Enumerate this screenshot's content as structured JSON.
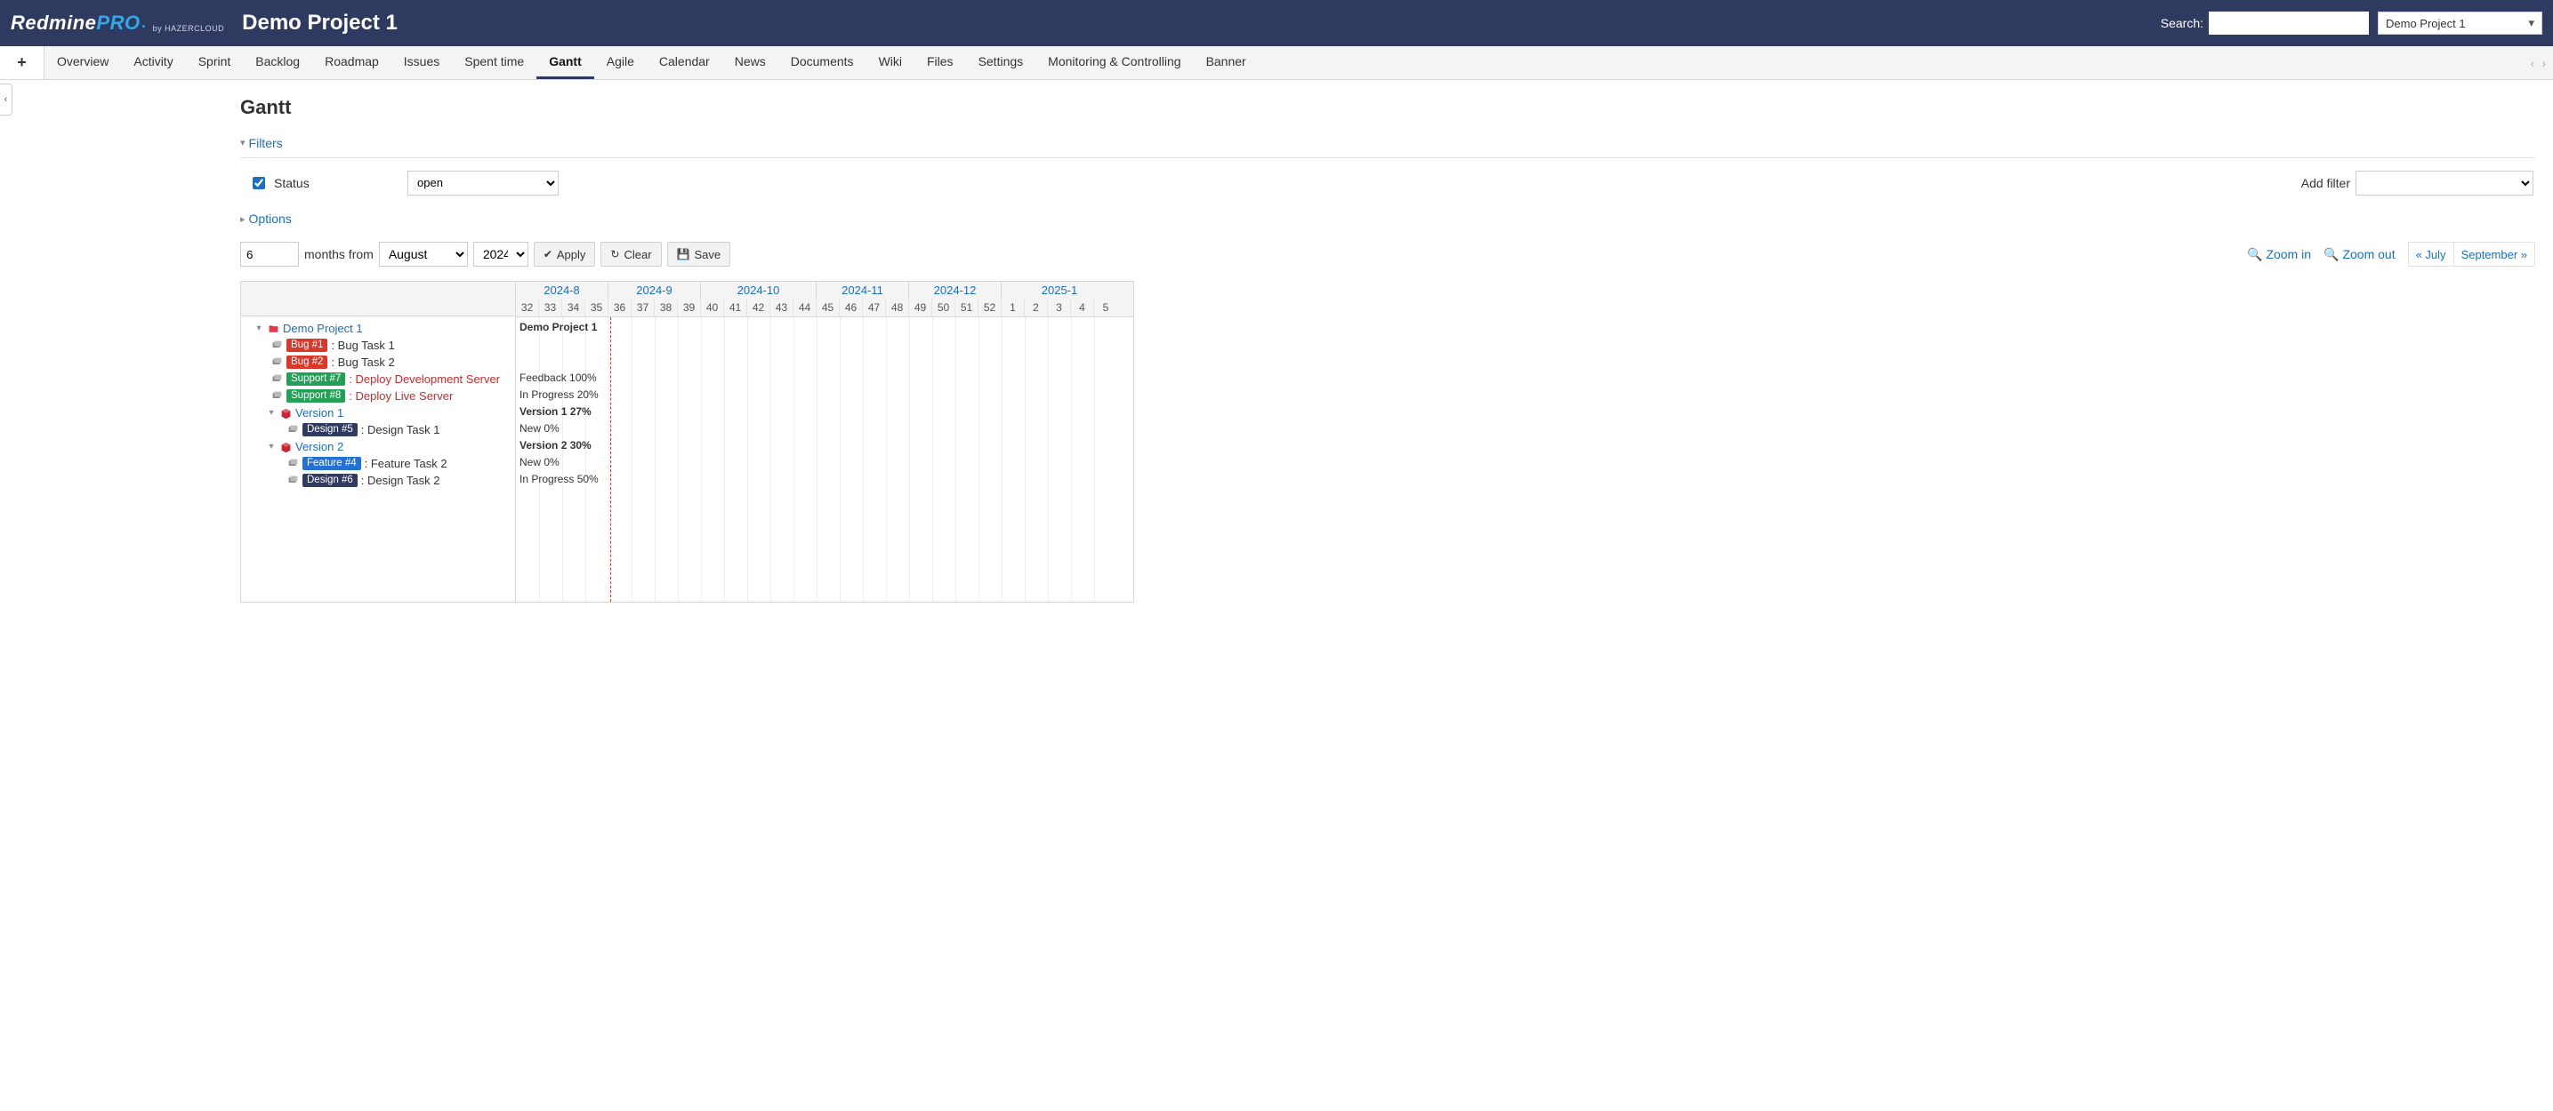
{
  "header": {
    "brand_main": "Redmine",
    "brand_accent": "PRO",
    "brand_sub": "by HAZERCLOUD",
    "project_title": "Demo Project 1",
    "search_label": "Search:",
    "project_selector": "Demo Project 1"
  },
  "tabs": {
    "items": [
      "Overview",
      "Activity",
      "Sprint",
      "Backlog",
      "Roadmap",
      "Issues",
      "Spent time",
      "Gantt",
      "Agile",
      "Calendar",
      "News",
      "Documents",
      "Wiki",
      "Files",
      "Settings",
      "Monitoring & Controlling",
      "Banner"
    ],
    "active_index": 7
  },
  "page": {
    "title": "Gantt",
    "filters_label": "Filters",
    "options_label": "Options",
    "status_label": "Status",
    "status_value": "open",
    "add_filter_label": "Add filter",
    "months_value": "6",
    "months_from_label": "months from",
    "month_value": "August",
    "year_value": "2024",
    "apply_label": "Apply",
    "clear_label": "Clear",
    "save_label": "Save",
    "zoom_in_label": "Zoom in",
    "zoom_out_label": "Zoom out",
    "prev_nav": "« July",
    "next_nav": "September »"
  },
  "timeline": {
    "months": [
      {
        "label": "2024-8",
        "weeks": [
          "32",
          "33",
          "34",
          "35"
        ]
      },
      {
        "label": "2024-9",
        "weeks": [
          "36",
          "37",
          "38",
          "39"
        ]
      },
      {
        "label": "2024-10",
        "weeks": [
          "40",
          "41",
          "42",
          "43",
          "44"
        ]
      },
      {
        "label": "2024-11",
        "weeks": [
          "45",
          "46",
          "47",
          "48"
        ]
      },
      {
        "label": "2024-12",
        "weeks": [
          "49",
          "50",
          "51",
          "52"
        ]
      },
      {
        "label": "2025-1",
        "weeks": [
          "1",
          "2",
          "3",
          "4",
          "5"
        ]
      }
    ]
  },
  "tree": {
    "root": {
      "label": "Demo Project 1"
    },
    "items": [
      {
        "type": "issue",
        "badge": "Bug #1",
        "badge_class": "bug",
        "text": ": Bug Task 1",
        "link": false
      },
      {
        "type": "issue",
        "badge": "Bug #2",
        "badge_class": "bug",
        "text": ": Bug Task 2",
        "link": false
      },
      {
        "type": "issue",
        "badge": "Support #7",
        "badge_class": "support",
        "text": ": Deploy Development Server",
        "link": true
      },
      {
        "type": "issue",
        "badge": "Support #8",
        "badge_class": "support",
        "text": ": Deploy Live Server",
        "link": true
      }
    ],
    "version1": {
      "label": "Version 1",
      "items": [
        {
          "badge": "Design #5",
          "badge_class": "design",
          "text": ": Design Task 1"
        }
      ]
    },
    "version2": {
      "label": "Version 2",
      "items": [
        {
          "badge": "Feature #4",
          "badge_class": "feature",
          "text": ": Feature Task 2"
        },
        {
          "badge": "Design #6",
          "badge_class": "design",
          "text": ": Design Task 2"
        }
      ]
    }
  },
  "gantt_labels": [
    {
      "text": "Demo Project 1",
      "bold": true
    },
    {
      "text": ""
    },
    {
      "text": ""
    },
    {
      "text": "Feedback 100%"
    },
    {
      "text": "In Progress 20%"
    },
    {
      "text": "Version 1 27%",
      "bold": true
    },
    {
      "text": "New 0%"
    },
    {
      "text": "Version 2 30%",
      "bold": true
    },
    {
      "text": "New 0%"
    },
    {
      "text": "In Progress 50%"
    }
  ]
}
